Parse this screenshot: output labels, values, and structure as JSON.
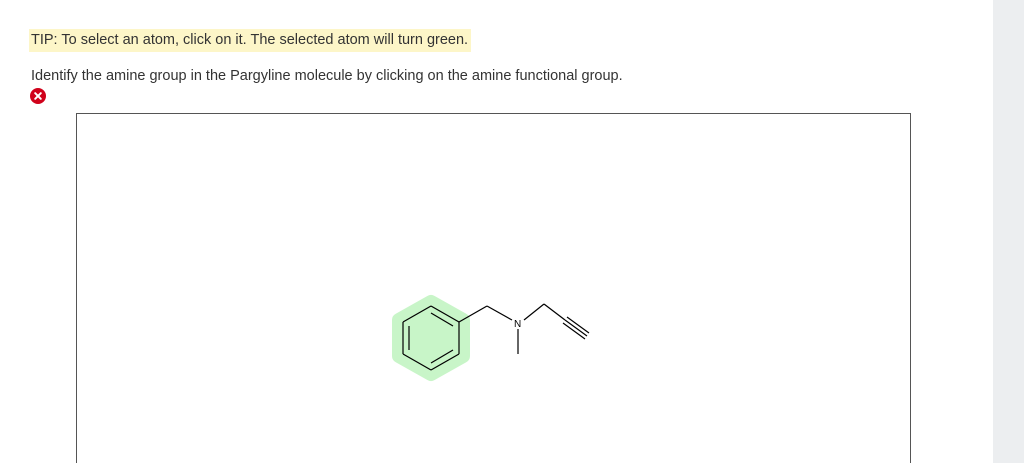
{
  "tip": {
    "text": "TIP: To select an atom, click on it. The selected atom will turn green."
  },
  "question": {
    "text": "Identify the amine group in the Pargyline molecule by clicking on the amine functional group."
  },
  "status": {
    "icon": "incorrect-x-icon",
    "color": "#d0021b"
  },
  "molecule": {
    "name": "Pargyline",
    "atom_labels": {
      "nitrogen": "N"
    },
    "highlight_color": "#c8f5c8",
    "selected_group": "benzene-ring"
  },
  "colors": {
    "tip_background": "#fdf6c8",
    "gutter": "#eceef0",
    "text": "#333333"
  }
}
